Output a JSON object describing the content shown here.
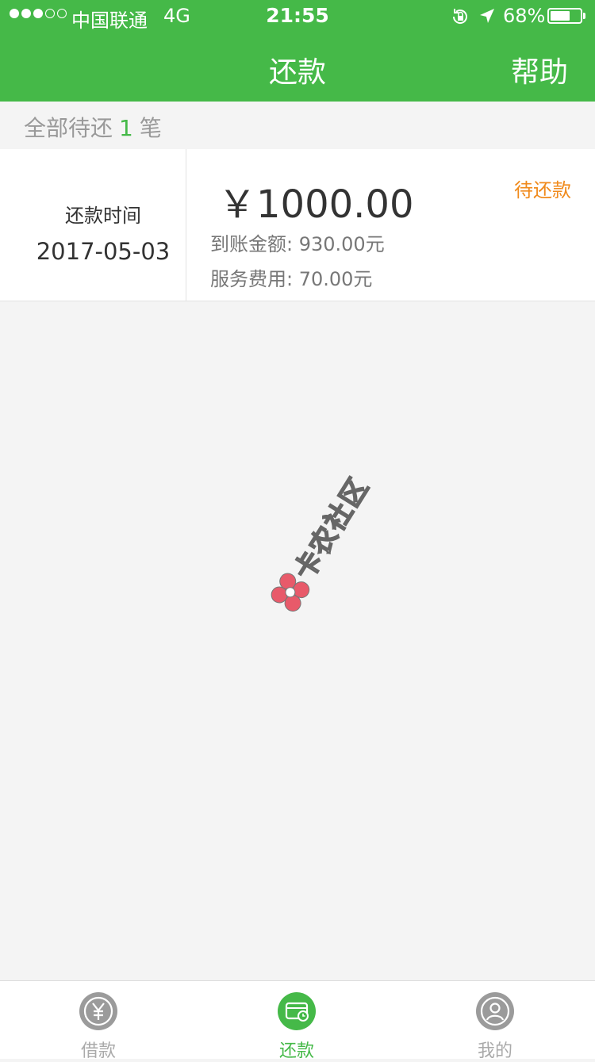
{
  "status_bar": {
    "carrier": "中国联通",
    "network": "4G",
    "time": "21:55",
    "battery": "68%",
    "battery_level": 0.68
  },
  "header": {
    "title": "还款",
    "help_label": "帮助"
  },
  "summary": {
    "prefix": "全部待还",
    "count": "1",
    "suffix": "笔"
  },
  "repayment": {
    "date_label": "还款时间",
    "date": "2017-05-03",
    "amount": "￥1000.00",
    "received": "到账金额: 930.00元",
    "fee": "服务费用: 70.00元",
    "status": "待还款"
  },
  "watermark": {
    "text": "卡农社区"
  },
  "tabbar": {
    "items": [
      {
        "label": "借款",
        "icon": "yuan-icon"
      },
      {
        "label": "还款",
        "icon": "card-clock-icon"
      },
      {
        "label": "我的",
        "icon": "user-icon"
      }
    ],
    "active": "还款"
  },
  "colors": {
    "brand_green": "#45b948",
    "pending_orange": "#f08a1c"
  }
}
